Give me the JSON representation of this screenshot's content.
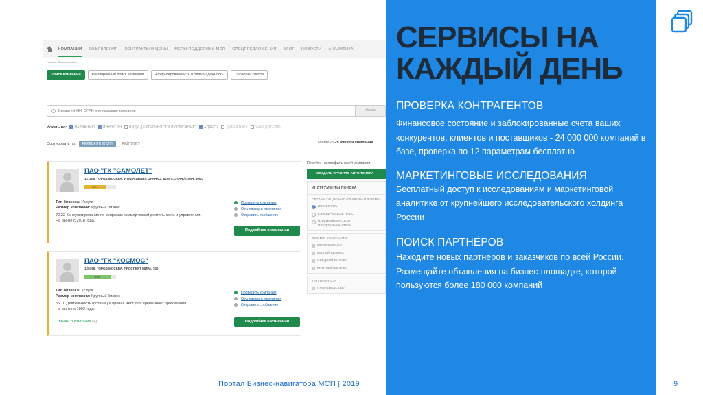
{
  "screenshot": {
    "nav": [
      "КОМПАНИИ",
      "ОБЪЯВЛЕНИЯ",
      "КОНТРАКТЫ И ЦЕНЫ",
      "МЕРЫ ПОДДЕРЖКИ МСП",
      "СПЕЦПРЕДЛОЖЕНИЯ",
      "БЛОГ",
      "НОВОСТИ",
      "АНАЛИТИКА"
    ],
    "breadcrumb": "Главная / Поиск компаний",
    "buttons": [
      "Поиск компаний",
      "Расширенный поиск компаний",
      "Аффилированность и благонадежность",
      "Проверка счетов"
    ],
    "search_placeholder": "Введите ИНН, ОГРН или название компании",
    "search_button": "Искать",
    "find_in_label": "Искать по:",
    "find_in": [
      {
        "label": "НАЗВАНИЮ",
        "on": true
      },
      {
        "label": "ИНН/ОГРН",
        "on": true
      },
      {
        "label": "ВИДУ ДЕЯТЕЛЬНОСТИ И ОПИСАНИЮ",
        "on": false
      },
      {
        "label": "АДРЕСУ",
        "on": true
      },
      {
        "label": "ДИРЕКТОРУ",
        "on": false
      },
      {
        "label": "УЧРЕДИТЕЛЮ",
        "on": false
      }
    ],
    "sort_label": "Сортировать по:",
    "sort": [
      {
        "label": "РЕЛЕВАНТНОСТИ",
        "on": true
      },
      {
        "label": "РЕЙТИНГУ",
        "on": false
      }
    ],
    "found_prefix": "Найдено",
    "found_count": "25 090 669",
    "found_suffix": "компаний",
    "cards": [
      {
        "name": "ПАО \"ГК \"САМОЛЕТ\"",
        "address": "121108, ГОРОД МОСКВА, УЛИЦА ИВАНА ФРАНКО, ДОМ 8, ЭТАЖ/КОМН. 10/23",
        "rating_label": "67%",
        "rating": 0.67,
        "rating_color": "#e3b431",
        "type_label": "Тип бизнеса:",
        "type": "Услуги",
        "size_label": "Размер компании:",
        "size": "Крупный бизнес",
        "activity": "70.22 Консультирование по вопросам коммерческой деятельности и управления.",
        "market": "На рынке с 2018 года.",
        "links": [
          "Проверить компанию",
          "Отслеживать изменения",
          "Отправить сообщение"
        ],
        "more": "Подробнее о компании",
        "reviews": ""
      },
      {
        "name": "ПАО \"ГК \"КОСМОС\"",
        "address": "129366, ГОРОД МОСКВА, ПРОСПЕКТ МИРА, 150",
        "rating_label": "83%",
        "rating": 0.83,
        "rating_color": "#7cc36b",
        "type_label": "Тип бизнеса:",
        "type": "Услуги",
        "size_label": "Размер компании:",
        "size": "Крупный бизнес",
        "activity": "55.10 Деятельность гостиниц и прочих мест для временного проживания.",
        "market": "На рынке с 1992 года.",
        "links": [
          "Проверить компанию",
          "Отслеживать изменения",
          "Отправить сообщение"
        ],
        "more": "Подробнее о компании",
        "reviews": "Отзывы о компании",
        "reviews_count": "(4)"
      }
    ],
    "profile_link": "Перейти на профиль моей компании",
    "auto_button": "СОЗДАТЬ ПРАВИЛО АВТОПОИСКА",
    "tools_header": "ИНСТРУМЕНТЫ ПОИСКА",
    "legal_form_header": "ОРГАНИЗАЦИОННО-ПРАВОВАЯ ФОРМА",
    "legal_forms": [
      {
        "label": "ВСЕ ФОРМЫ",
        "on": true
      },
      {
        "label": "ЮРИДИЧЕСКОЕ ЛИЦО",
        "on": false
      },
      {
        "label": "ИНДИВИДУАЛЬНЫЙ ПРЕДПРИНИМАТЕЛЬ",
        "on": false
      }
    ],
    "size_header": "РАЗМЕР КОМПАНИИ",
    "sizes": [
      "МИКРОБИЗНЕС",
      "МАЛЫЙ БИЗНЕС",
      "СРЕДНИЙ БИЗНЕС",
      "КРУПНЫЙ БИЗНЕС"
    ],
    "biztype_header": "ТИП БИЗНЕСА",
    "biztypes": [
      "ПРОИЗВОДСТВО"
    ]
  },
  "slide": {
    "title_line1": "СЕРВИСЫ НА",
    "title_line2": "КАЖДЫЙ ДЕНЬ",
    "sections": [
      {
        "heading": "ПРОВЕРКА КОНТРАГЕНТОВ",
        "body": "Финансовое состояние и заблокированные счета ваших конкурентов,  клиентов и поставщиков - 24 000 000 компаний в базе, проверка по 12 параметрам бесплатно"
      },
      {
        "heading": "МАРКЕТИНГОВЫЕ ИССЛЕДОВАНИЯ",
        "body": "Бесплатный доступ к исследованиям и маркетинговой аналитике от крупнейшего исследовательского холдинга России"
      },
      {
        "heading": "ПОИСК ПАРТНЁРОВ",
        "body": "Находите новых партнеров и заказчиков по всей России. Размещайте объявления на бизнес-площадке, которой пользуются более 180 000 компаний"
      }
    ],
    "footer": "Портал Бизнес-навигатора МСП | 2019",
    "page_number": "9",
    "logo_icon": "stacked-squares-icon"
  },
  "colors": {
    "blue_panel": "#1f88e5",
    "title": "#1d2b3a",
    "green": "#1f8a4c",
    "footer": "#1f6fd0"
  }
}
